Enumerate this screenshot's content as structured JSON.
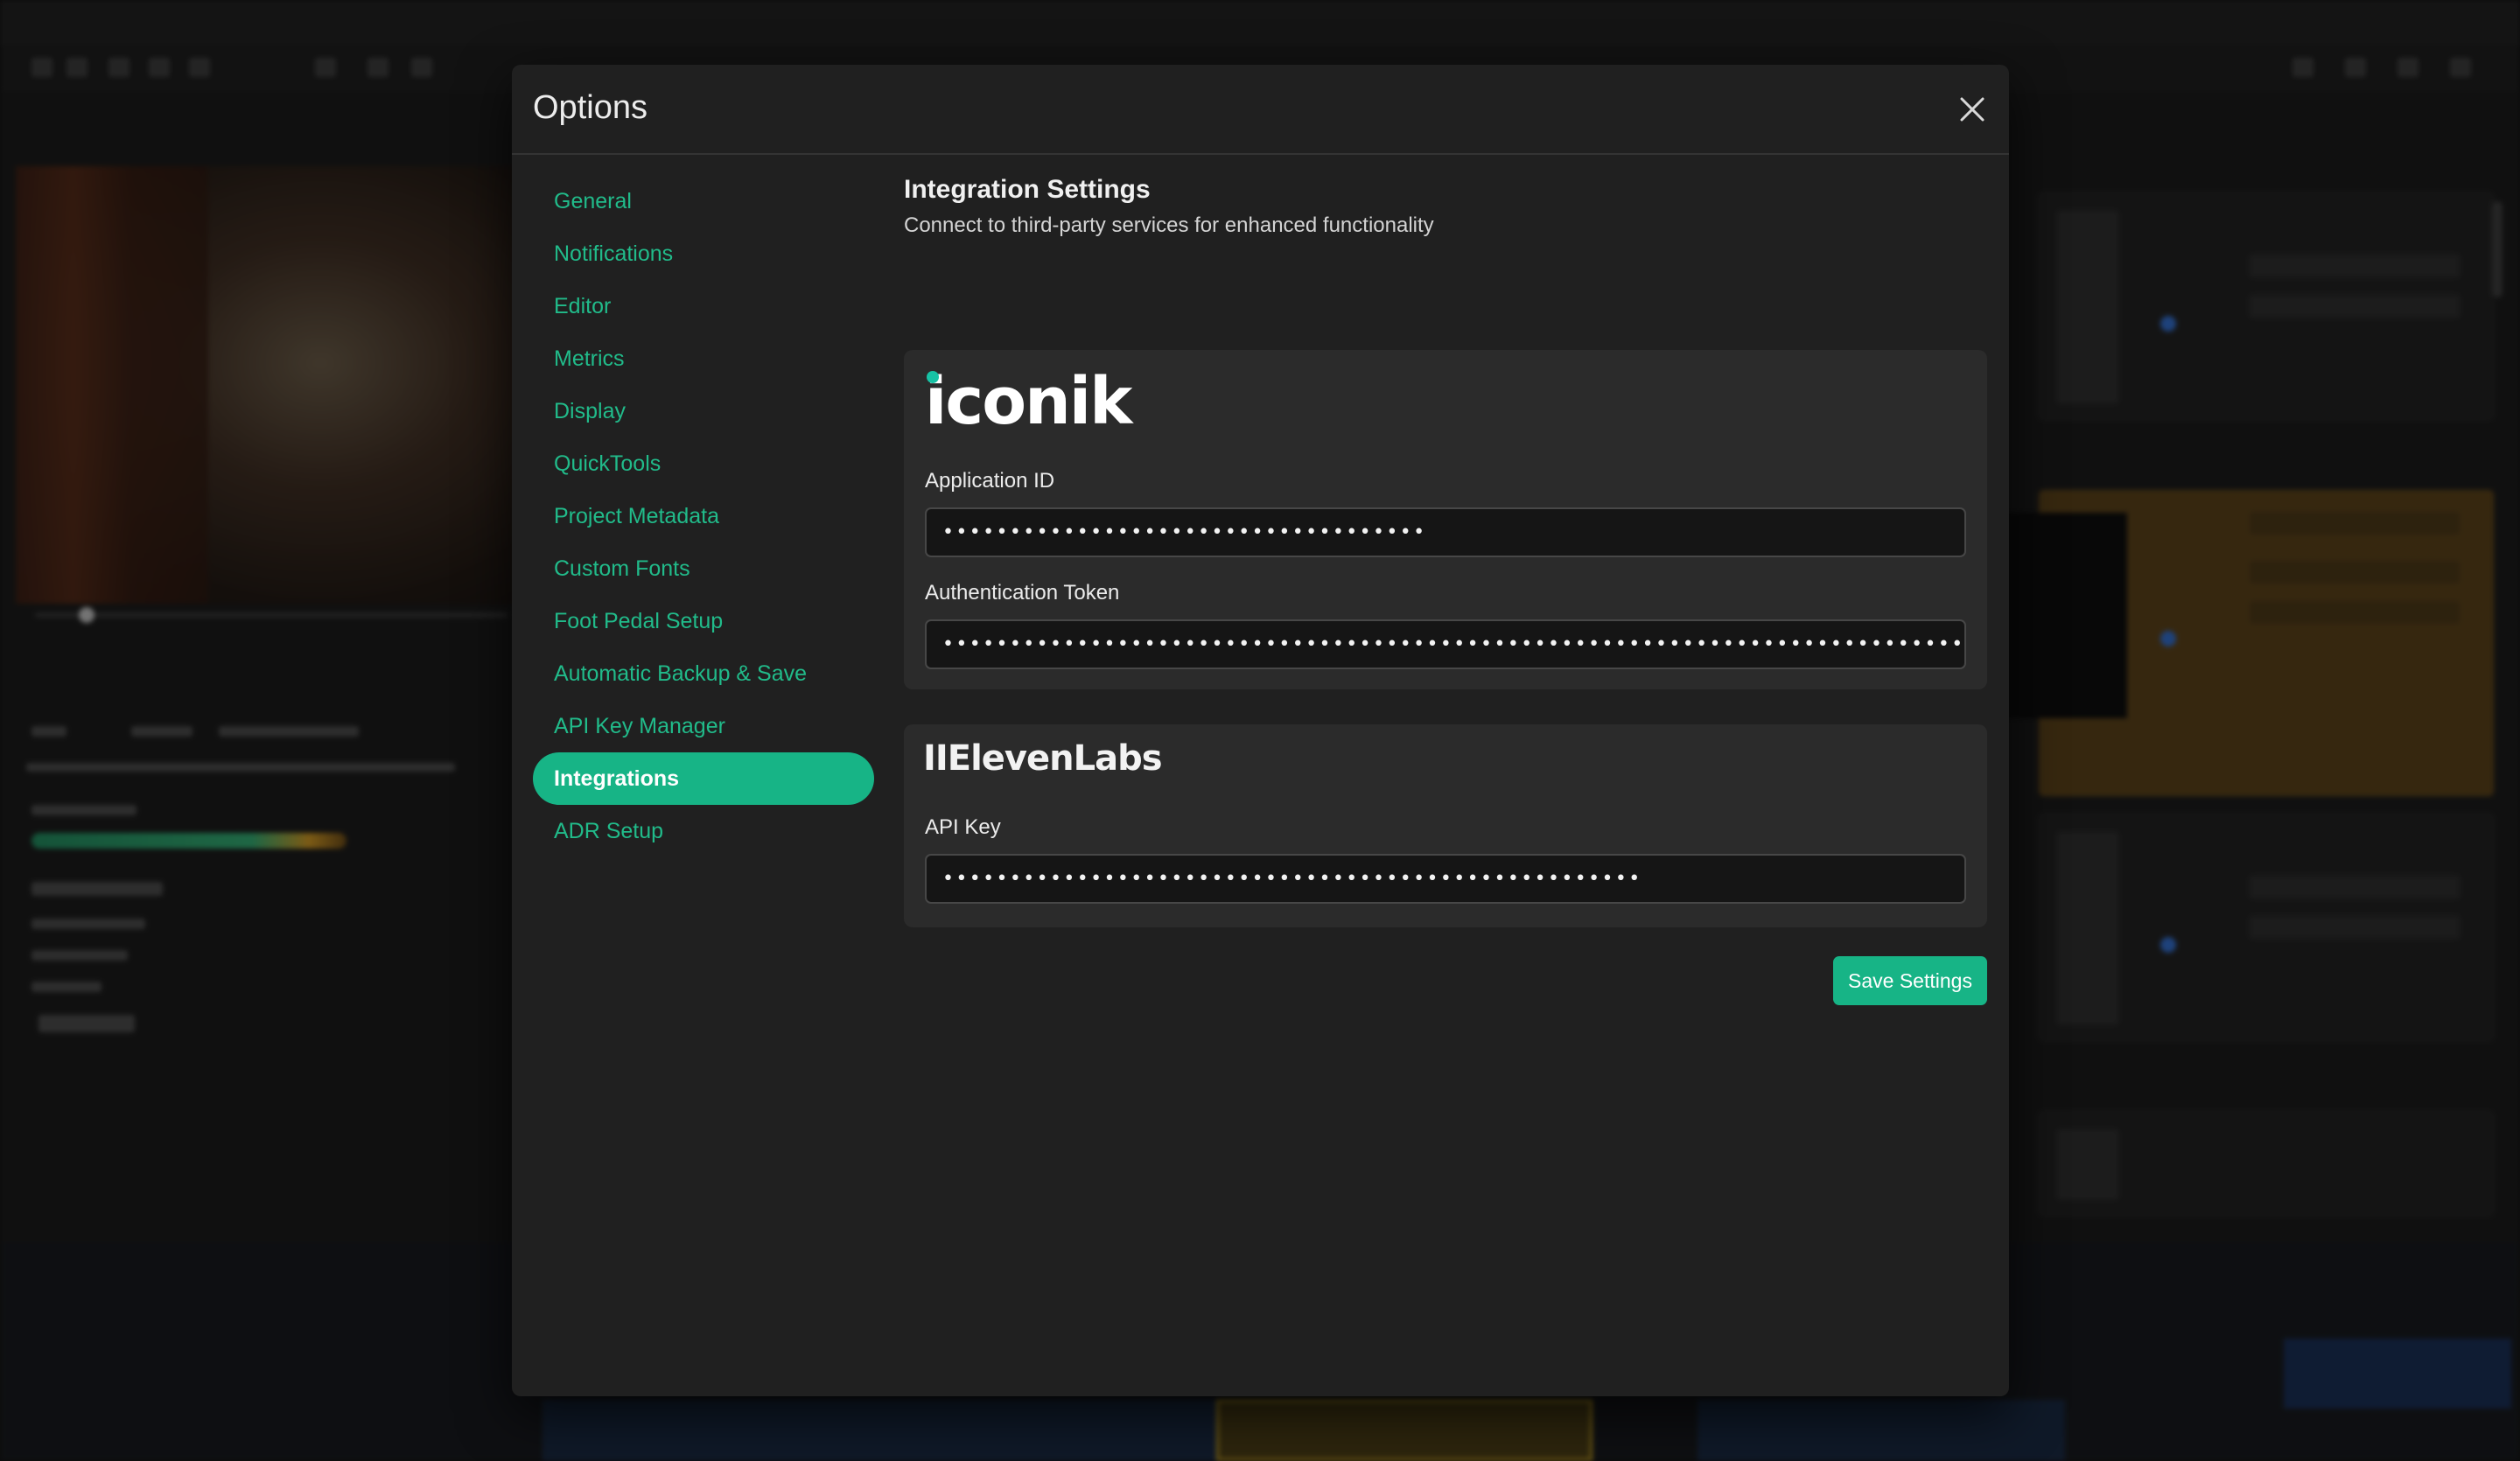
{
  "modal": {
    "title": "Options",
    "close_icon": "close-icon"
  },
  "sidebar": {
    "items": [
      {
        "label": "General",
        "active": false
      },
      {
        "label": "Notifications",
        "active": false
      },
      {
        "label": "Editor",
        "active": false
      },
      {
        "label": "Metrics",
        "active": false
      },
      {
        "label": "Display",
        "active": false
      },
      {
        "label": "QuickTools",
        "active": false
      },
      {
        "label": "Project Metadata",
        "active": false
      },
      {
        "label": "Custom Fonts",
        "active": false
      },
      {
        "label": "Foot Pedal Setup",
        "active": false
      },
      {
        "label": "Automatic Backup & Save",
        "active": false
      },
      {
        "label": "API Key Manager",
        "active": false
      },
      {
        "label": "Integrations",
        "active": true
      },
      {
        "label": "ADR Setup",
        "active": false
      }
    ]
  },
  "content": {
    "title": "Integration Settings",
    "subtitle": "Connect to third-party services for enhanced functionality"
  },
  "iconik": {
    "logo_text": "iconik",
    "app_id_label": "Application ID",
    "app_id_value": "••••••••••••••••••••••••••••••••••••",
    "auth_token_label": "Authentication Token",
    "auth_token_value": "•••••••••••••••••••••••••••••••••••••••••••••••••••••••••••••••••••••••••••••••••••••••••••••••••••••"
  },
  "elevenlabs": {
    "logo_text": "IIElevenLabs",
    "api_key_label": "API Key",
    "api_key_value": "••••••••••••••••••••••••••••••••••••••••••••••••••••"
  },
  "actions": {
    "save_label": "Save Settings"
  },
  "colors": {
    "accent": "#17b486",
    "link": "#21bb8a",
    "modal_bg": "#202020",
    "card_bg": "#2b2b2b",
    "iconik_dot": "#17c2a5"
  }
}
